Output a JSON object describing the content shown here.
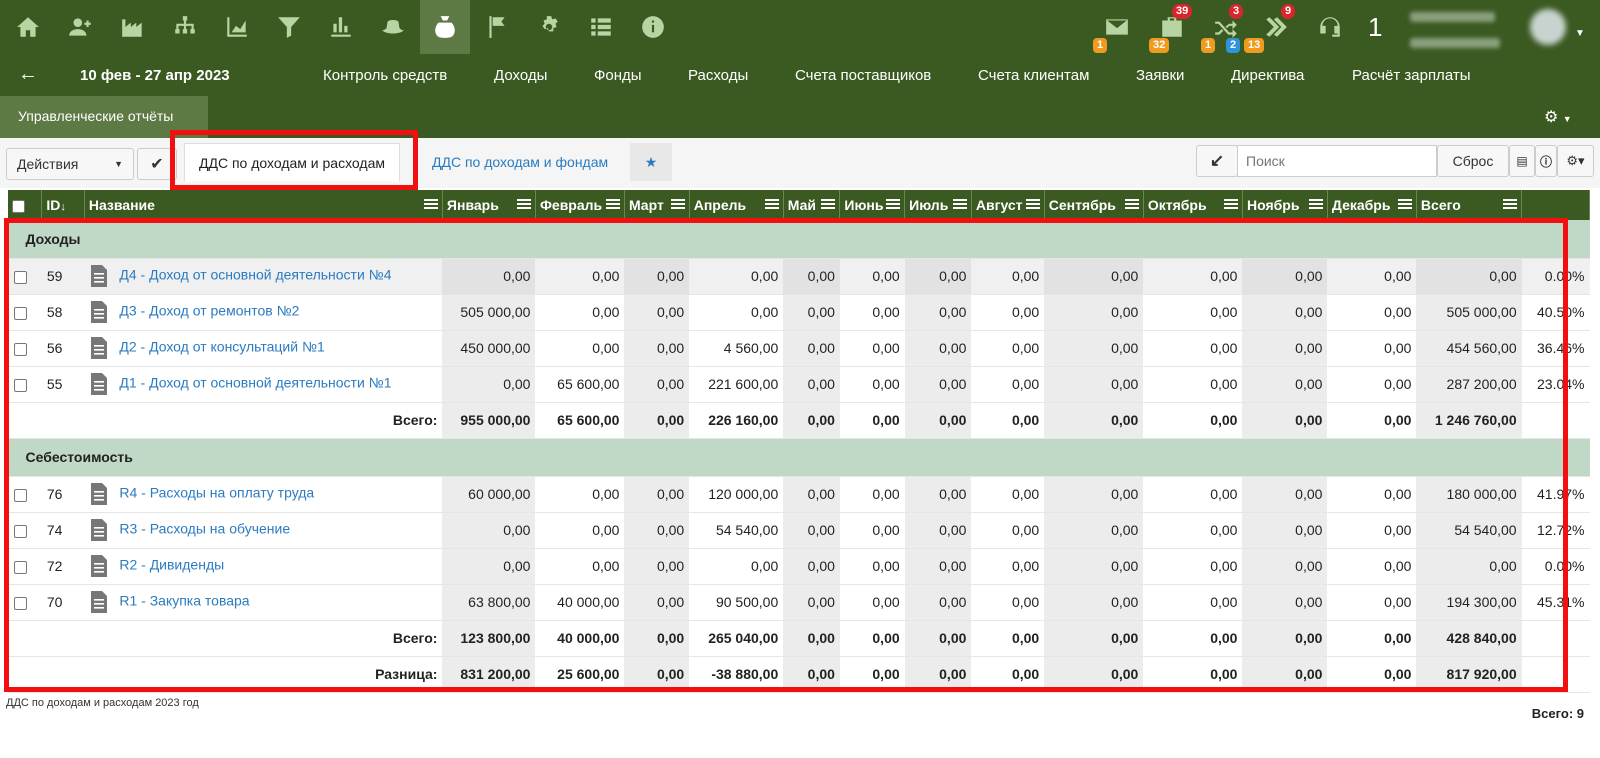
{
  "badges": {
    "mail": "1",
    "tasks_top": "39",
    "tasks_bottom": "32",
    "shuffle_top": "3",
    "shuffle_left": "1",
    "shuffle_mid": "2",
    "shuffle_right": "13",
    "arrows_top": "9",
    "counter": "1"
  },
  "nav_icons": [
    "home-icon",
    "user-add-icon",
    "factory-icon",
    "sitemap-icon",
    "area-chart-icon",
    "filter-icon",
    "bar-chart-icon",
    "hat-icon",
    "money-bag-icon",
    "flag-icon",
    "gear-icon",
    "list-icon",
    "info-icon"
  ],
  "bar2": {
    "date_range": "10 фев - 27 апр 2023",
    "items": [
      "Контроль средств",
      "Доходы",
      "Фонды",
      "Расходы",
      "Счета поставщиков",
      "Счета клиентам",
      "Заявки",
      "Директива",
      "Расчёт зарплаты"
    ]
  },
  "bar3": {
    "tab": "Управленческие отчёты"
  },
  "toolbar": {
    "actions": "Действия",
    "tab_active": "ДДС по доходам и расходам",
    "tab_other": "ДДС по доходам и фондам",
    "search_placeholder": "Поиск",
    "reset": "Сброс"
  },
  "columns": [
    "ID",
    "Название",
    "Январь",
    "Февраль",
    "Март",
    "Апрель",
    "Май",
    "Июнь",
    "Июль",
    "Август",
    "Сентябрь",
    "Октябрь",
    "Ноябрь",
    "Декабрь",
    "Всего"
  ],
  "groups": [
    {
      "title": "Доходы",
      "rows": [
        {
          "id": "59",
          "name": "Д4 - Доход от основной деятельности №4",
          "vals": [
            "0,00",
            "0,00",
            "0,00",
            "0,00",
            "0,00",
            "0,00",
            "0,00",
            "0,00",
            "0,00",
            "0,00",
            "0,00",
            "0,00"
          ],
          "total": "0,00",
          "pct": "0.00%",
          "color": "#8e44ad"
        },
        {
          "id": "58",
          "name": "Д3 - Доход от ремонтов №2",
          "vals": [
            "505 000,00",
            "0,00",
            "0,00",
            "0,00",
            "0,00",
            "0,00",
            "0,00",
            "0,00",
            "0,00",
            "0,00",
            "0,00",
            "0,00"
          ],
          "total": "505 000,00",
          "pct": "40.50%",
          "color": "#f0f0f0"
        },
        {
          "id": "56",
          "name": "Д2 - Доход от консультаций №1",
          "vals": [
            "450 000,00",
            "0,00",
            "0,00",
            "4 560,00",
            "0,00",
            "0,00",
            "0,00",
            "0,00",
            "0,00",
            "0,00",
            "0,00",
            "0,00"
          ],
          "total": "454 560,00",
          "pct": "36.46%",
          "color": "#f1c40f"
        },
        {
          "id": "55",
          "name": "Д1 - Доход от основной деятельности №1",
          "vals": [
            "0,00",
            "65 600,00",
            "0,00",
            "221 600,00",
            "0,00",
            "0,00",
            "0,00",
            "0,00",
            "0,00",
            "0,00",
            "0,00",
            "0,00"
          ],
          "total": "287 200,00",
          "pct": "23.04%",
          "color": "#f0f0f0"
        }
      ],
      "total_label": "Всего:",
      "totals": [
        "955 000,00",
        "65 600,00",
        "0,00",
        "226 160,00",
        "0,00",
        "0,00",
        "0,00",
        "0,00",
        "0,00",
        "0,00",
        "0,00",
        "0,00"
      ],
      "grand": "1 246 760,00"
    },
    {
      "title": "Себестоимость",
      "rows": [
        {
          "id": "76",
          "name": "R4 - Расходы на оплату труда",
          "vals": [
            "60 000,00",
            "0,00",
            "0,00",
            "120 000,00",
            "0,00",
            "0,00",
            "0,00",
            "0,00",
            "0,00",
            "0,00",
            "0,00",
            "0,00"
          ],
          "total": "180 000,00",
          "pct": "41.97%",
          "color": "#e67e22"
        },
        {
          "id": "74",
          "name": "R3 - Расходы на обучение",
          "vals": [
            "0,00",
            "0,00",
            "0,00",
            "54 540,00",
            "0,00",
            "0,00",
            "0,00",
            "0,00",
            "0,00",
            "0,00",
            "0,00",
            "0,00"
          ],
          "total": "54 540,00",
          "pct": "12.72%",
          "color": "#f0f0f0"
        },
        {
          "id": "72",
          "name": "R2 - Дивиденды",
          "vals": [
            "0,00",
            "0,00",
            "0,00",
            "0,00",
            "0,00",
            "0,00",
            "0,00",
            "0,00",
            "0,00",
            "0,00",
            "0,00",
            "0,00"
          ],
          "total": "0,00",
          "pct": "0.00%",
          "color": "#e91e63"
        },
        {
          "id": "70",
          "name": "R1 - Закупка товара",
          "vals": [
            "63 800,00",
            "40 000,00",
            "0,00",
            "90 500,00",
            "0,00",
            "0,00",
            "0,00",
            "0,00",
            "0,00",
            "0,00",
            "0,00",
            "0,00"
          ],
          "total": "194 300,00",
          "pct": "45.31%",
          "color": "#8e44ad"
        }
      ],
      "total_label": "Всего:",
      "totals": [
        "123 800,00",
        "40 000,00",
        "0,00",
        "265 040,00",
        "0,00",
        "0,00",
        "0,00",
        "0,00",
        "0,00",
        "0,00",
        "0,00",
        "0,00"
      ],
      "grand": "428 840,00"
    }
  ],
  "diff": {
    "label": "Разница:",
    "vals": [
      "831 200,00",
      "25 600,00",
      "0,00",
      "-38 880,00",
      "0,00",
      "0,00",
      "0,00",
      "0,00",
      "0,00",
      "0,00",
      "0,00",
      "0,00"
    ],
    "grand": "817 920,00"
  },
  "footer": {
    "caption": "ДДС по доходам и расходам 2023 год",
    "count": "Всего: 9"
  }
}
